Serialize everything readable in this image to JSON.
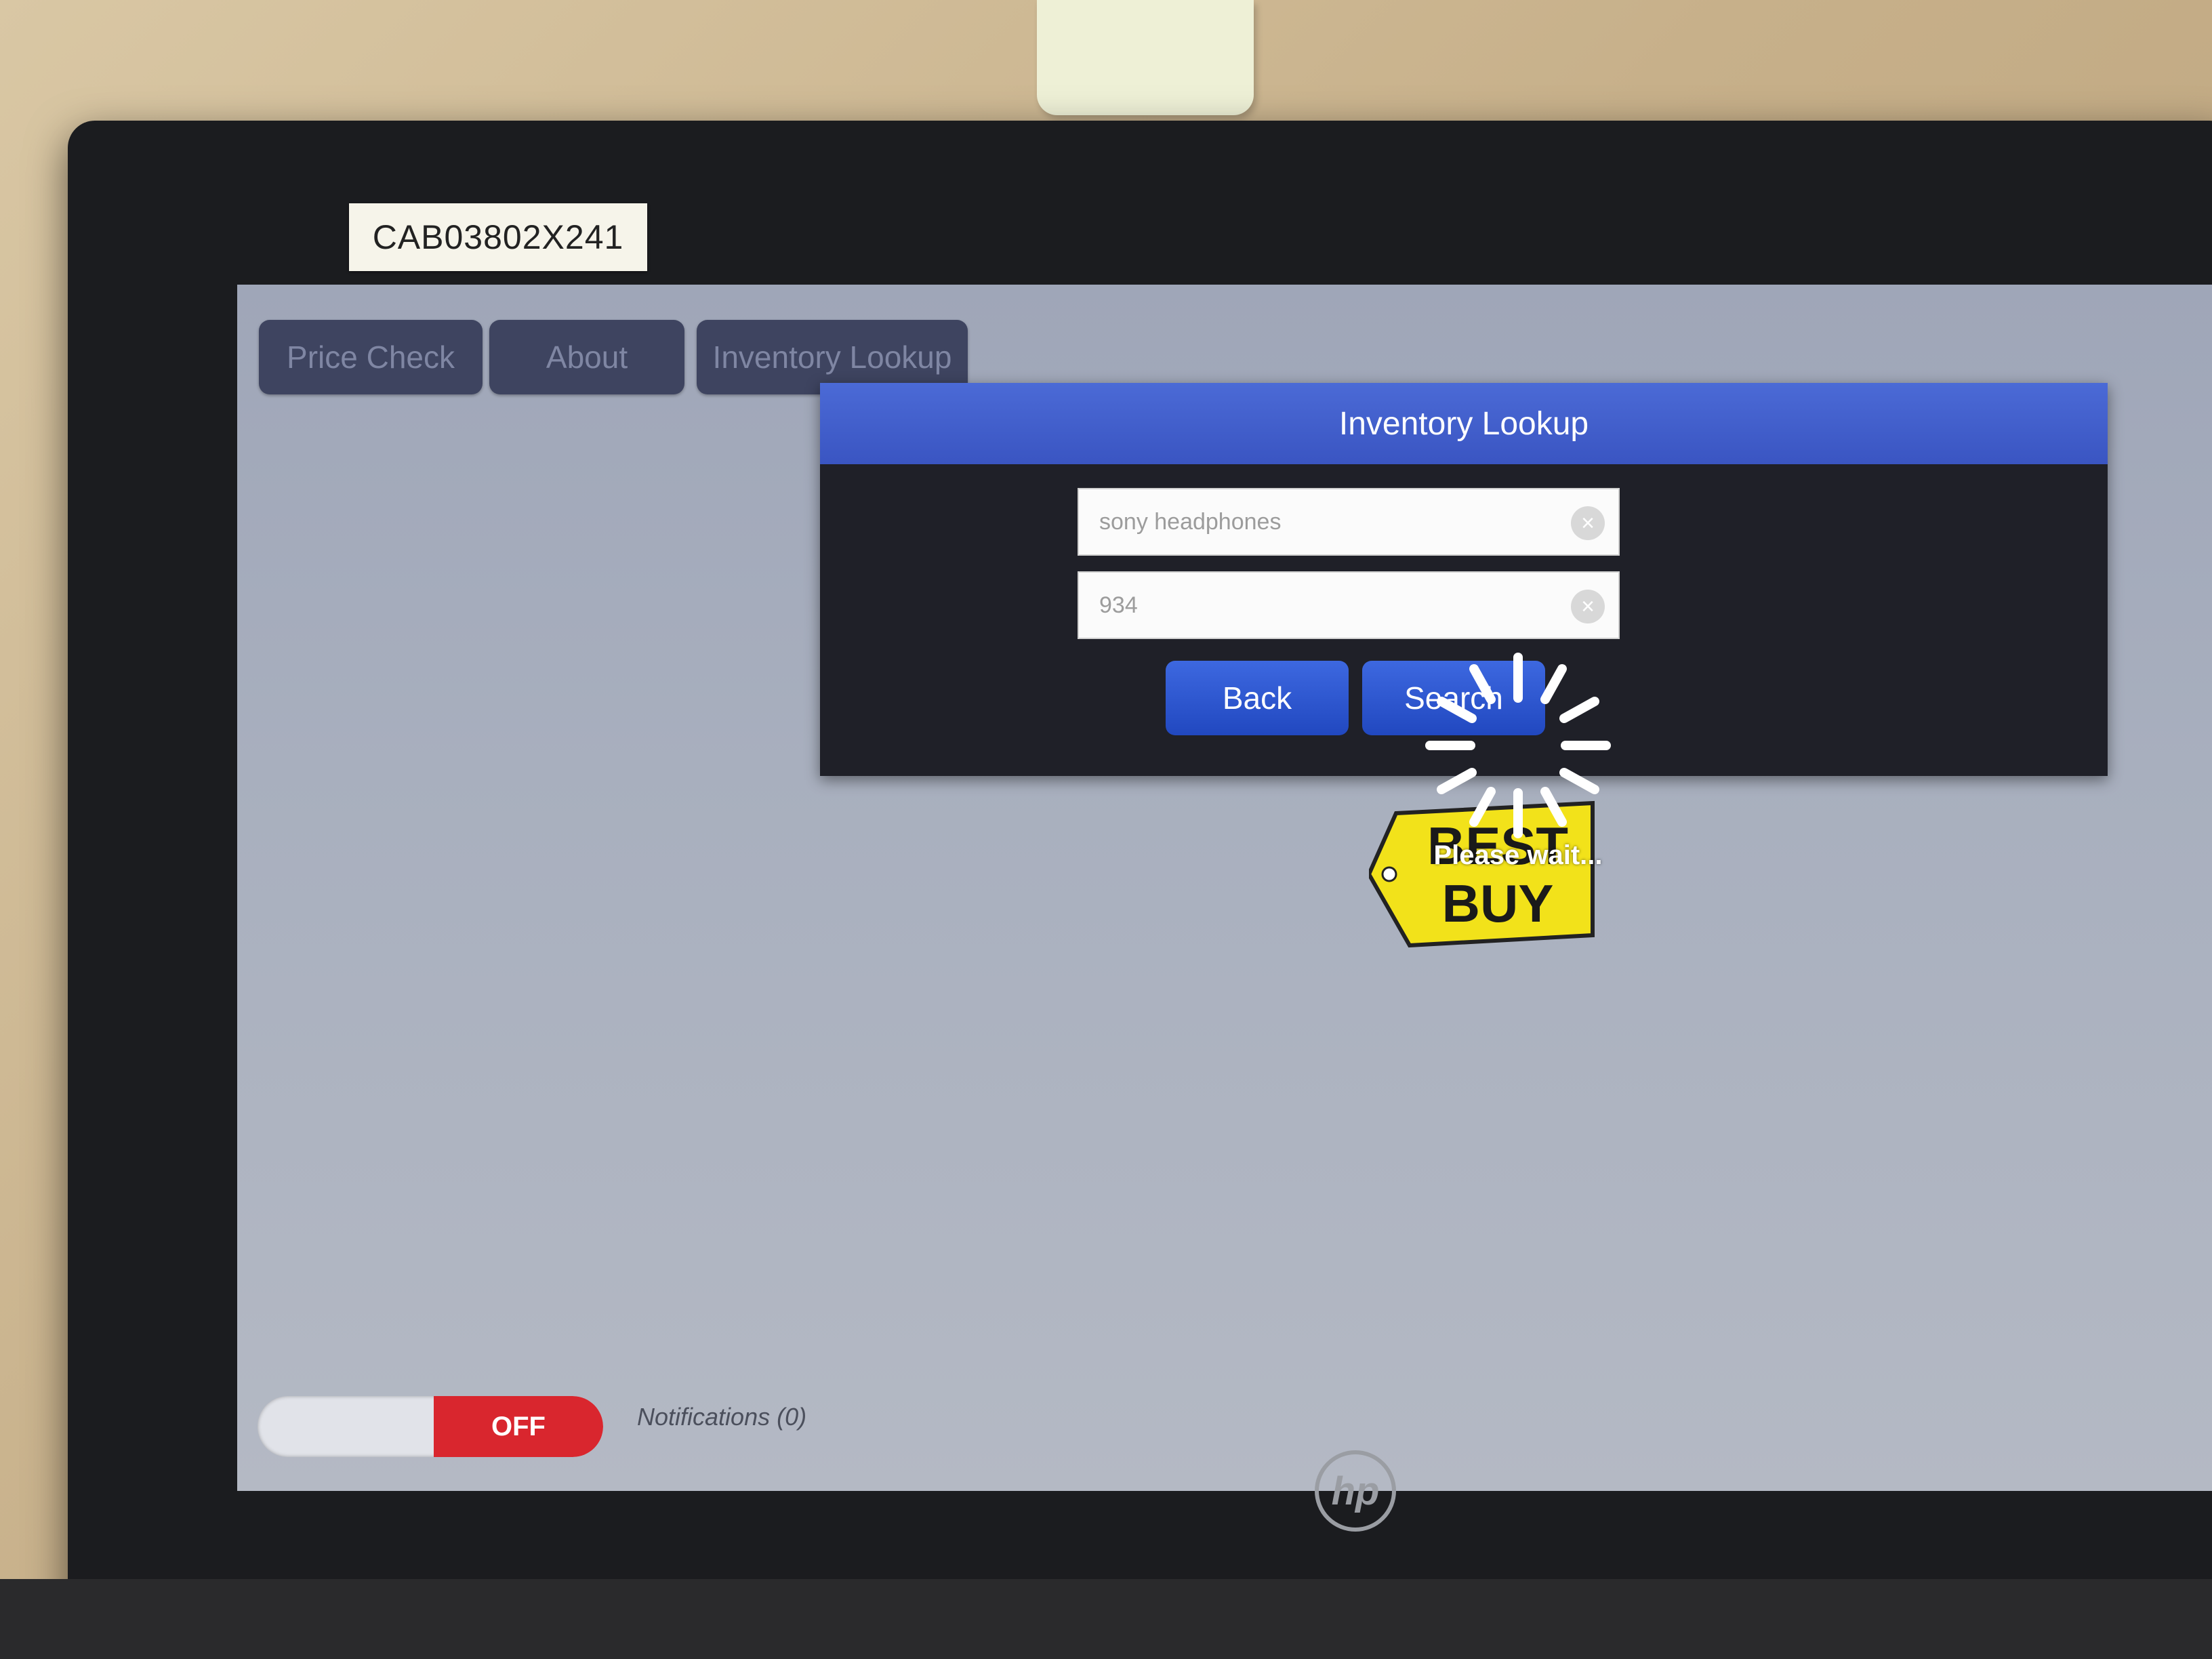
{
  "asset_tag": "CAB03802X241",
  "nav": {
    "tabs": [
      {
        "label": "Price Check"
      },
      {
        "label": "About"
      },
      {
        "label": "Inventory Lookup"
      }
    ]
  },
  "dialog": {
    "title": "Inventory Lookup",
    "query_value": "sony headphones",
    "store_value": "934",
    "clear_glyph": "×",
    "back_label": "Back",
    "search_label": "Search"
  },
  "loading": {
    "message": "Please wait..."
  },
  "brand_logo": {
    "line1": "BEST",
    "line2": "BUY",
    "color": "#f2e21a"
  },
  "footer": {
    "toggle_state": "OFF",
    "notifications": "Notifications (0)"
  },
  "monitor_brand": "hp",
  "colors": {
    "header_blue": "#4b6ad6",
    "button_blue": "#2a50c8",
    "toggle_red": "#d9262e"
  }
}
